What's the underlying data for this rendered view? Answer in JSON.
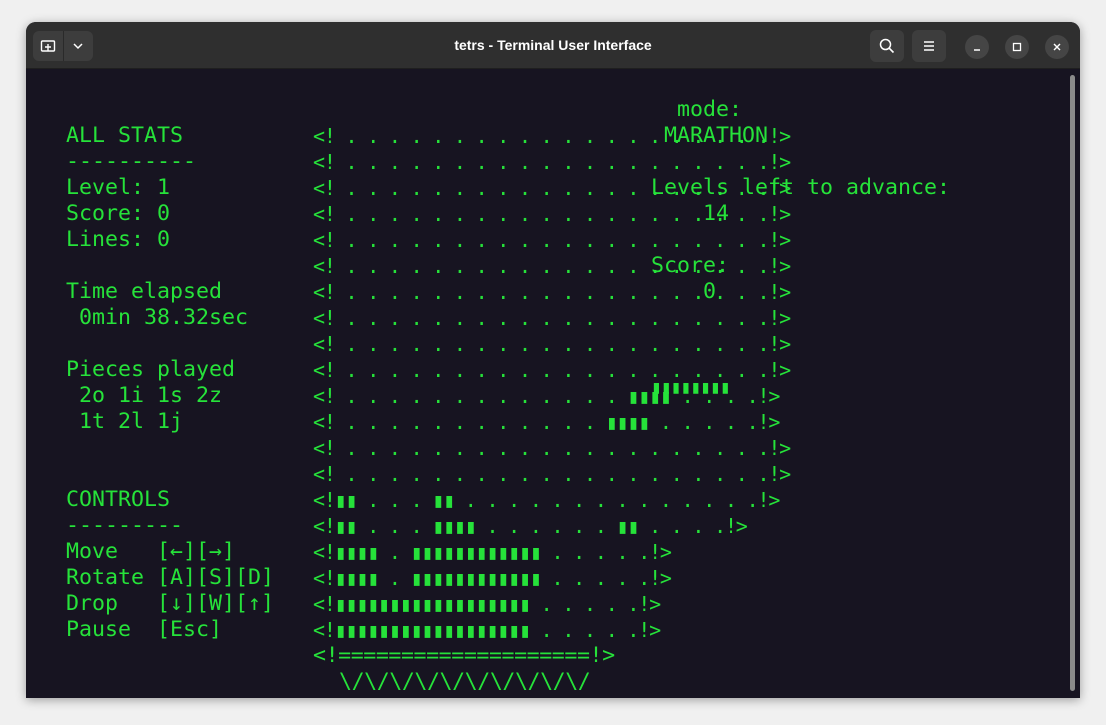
{
  "window": {
    "title": "tetrs - Terminal User Interface",
    "icons": {
      "new_tab": "new-tab-icon",
      "dropdown": "chevron-down-icon",
      "search": "search-icon",
      "menu": "hamburger-menu-icon",
      "minimize": "minimize-icon",
      "maximize": "maximize-icon",
      "close": "close-icon"
    }
  },
  "colors": {
    "terminal_bg": "#171421",
    "terminal_fg": "#26e23a",
    "titlebar_bg": "#2f2f2f"
  },
  "stats": {
    "heading": "ALL STATS",
    "heading_rule": "----------",
    "level": "Level: 1",
    "score": "Score: 0",
    "lines": "Lines: 0",
    "time_label": "Time elapsed",
    "time_value": " 0min 38.32sec",
    "pieces_label": "Pieces played",
    "pieces_row1": " 2o 1i 1s 2z",
    "pieces_row2": " 1t 2l 1j"
  },
  "controls": {
    "heading": "CONTROLS",
    "heading_rule": "---------",
    "move": "Move   [←][→]",
    "rotate": "Rotate [A][S][D]",
    "drop": "Drop   [↓][W][↑]",
    "pause": "Pause  [Esc]"
  },
  "board": {
    "rows": [
      "<! . . . . . . . . . . . . . . . . . . . .!>",
      "<! . . . . . . . . . . . . . . . . . . . .!>",
      "<! . . . . . . . . . . . . . . . . . . . .!>",
      "<! . . . . . . . . . . . . . . . . . . . .!>",
      "<! . . . . . . . . . . . . . . . . . . . .!>",
      "<! . . . . . . . . . . . . . . . . . . . .!>",
      "<! . . . . . . . . . . . . . . . . . . . .!>",
      "<! . . . . . . . . . . . . . . . . . . . .!>",
      "<! . . . . . . . . . . . . . . . . . . . .!>",
      "<! . . . . . . . . . . . . . . . . . . . .!>",
      "<! . . . . . . . . . . . . . ▮▮▮▮ . . . .!>",
      "<! . . . . . . . . . . . . ▮▮▮▮ . . . . .!>",
      "<! . . . . . . . . . . . . . . . . . . . .!>",
      "<! . . . . . . . . . . . . . . . . . . . .!>",
      "<!▮▮ . . . ▮▮ . . . . . . . . . . . . . .!>",
      "<!▮▮ . . . ▮▮▮▮ . . . . . . ▮▮ . . . .!>",
      "<!▮▮▮▮ . ▮▮▮▮▮▮▮▮▮▮▮▮ . . . . .!>",
      "<!▮▮▮▮ . ▮▮▮▮▮▮▮▮▮▮▮▮ . . . . .!>",
      "<!▮▮▮▮▮▮▮▮▮▮▮▮▮▮▮▮▮▮ . . . . .!>",
      "<!▮▮▮▮▮▮▮▮▮▮▮▮▮▮▮▮▮▮ . . . . .!>"
    ],
    "floor": "<!====================!>",
    "base": "\\/\\/\\/\\/\\/\\/\\/\\/\\/\\/"
  },
  "info": {
    "mode_label": "mode:",
    "mode_value": "MARATHON",
    "levels_label": "Levels left to advance:",
    "levels_value": "14",
    "score_label": "Score:",
    "score_value": "0",
    "next_piece": "▮▮▮▮▮▮▮▮"
  }
}
